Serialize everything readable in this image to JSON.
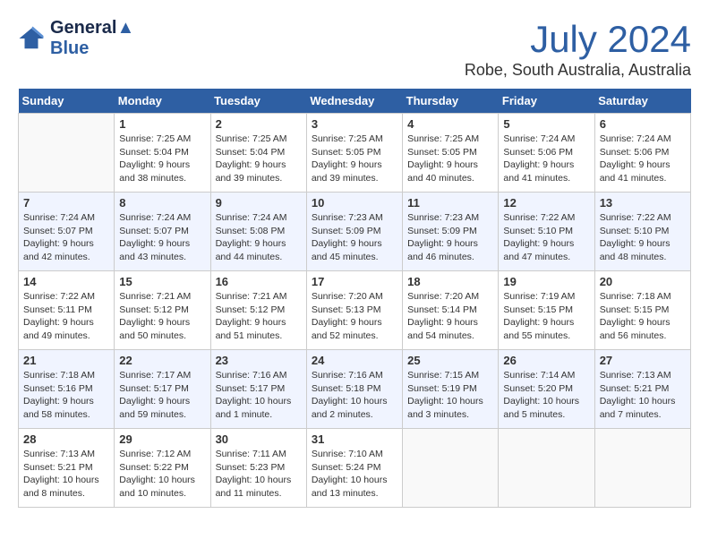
{
  "logo": {
    "line1": "General",
    "line2": "Blue"
  },
  "title": "July 2024",
  "location": "Robe, South Australia, Australia",
  "days_of_week": [
    "Sunday",
    "Monday",
    "Tuesday",
    "Wednesday",
    "Thursday",
    "Friday",
    "Saturday"
  ],
  "weeks": [
    [
      {
        "day": "",
        "info": ""
      },
      {
        "day": "1",
        "info": "Sunrise: 7:25 AM\nSunset: 5:04 PM\nDaylight: 9 hours\nand 38 minutes."
      },
      {
        "day": "2",
        "info": "Sunrise: 7:25 AM\nSunset: 5:04 PM\nDaylight: 9 hours\nand 39 minutes."
      },
      {
        "day": "3",
        "info": "Sunrise: 7:25 AM\nSunset: 5:05 PM\nDaylight: 9 hours\nand 39 minutes."
      },
      {
        "day": "4",
        "info": "Sunrise: 7:25 AM\nSunset: 5:05 PM\nDaylight: 9 hours\nand 40 minutes."
      },
      {
        "day": "5",
        "info": "Sunrise: 7:24 AM\nSunset: 5:06 PM\nDaylight: 9 hours\nand 41 minutes."
      },
      {
        "day": "6",
        "info": "Sunrise: 7:24 AM\nSunset: 5:06 PM\nDaylight: 9 hours\nand 41 minutes."
      }
    ],
    [
      {
        "day": "7",
        "info": "Sunrise: 7:24 AM\nSunset: 5:07 PM\nDaylight: 9 hours\nand 42 minutes."
      },
      {
        "day": "8",
        "info": "Sunrise: 7:24 AM\nSunset: 5:07 PM\nDaylight: 9 hours\nand 43 minutes."
      },
      {
        "day": "9",
        "info": "Sunrise: 7:24 AM\nSunset: 5:08 PM\nDaylight: 9 hours\nand 44 minutes."
      },
      {
        "day": "10",
        "info": "Sunrise: 7:23 AM\nSunset: 5:09 PM\nDaylight: 9 hours\nand 45 minutes."
      },
      {
        "day": "11",
        "info": "Sunrise: 7:23 AM\nSunset: 5:09 PM\nDaylight: 9 hours\nand 46 minutes."
      },
      {
        "day": "12",
        "info": "Sunrise: 7:22 AM\nSunset: 5:10 PM\nDaylight: 9 hours\nand 47 minutes."
      },
      {
        "day": "13",
        "info": "Sunrise: 7:22 AM\nSunset: 5:10 PM\nDaylight: 9 hours\nand 48 minutes."
      }
    ],
    [
      {
        "day": "14",
        "info": "Sunrise: 7:22 AM\nSunset: 5:11 PM\nDaylight: 9 hours\nand 49 minutes."
      },
      {
        "day": "15",
        "info": "Sunrise: 7:21 AM\nSunset: 5:12 PM\nDaylight: 9 hours\nand 50 minutes."
      },
      {
        "day": "16",
        "info": "Sunrise: 7:21 AM\nSunset: 5:12 PM\nDaylight: 9 hours\nand 51 minutes."
      },
      {
        "day": "17",
        "info": "Sunrise: 7:20 AM\nSunset: 5:13 PM\nDaylight: 9 hours\nand 52 minutes."
      },
      {
        "day": "18",
        "info": "Sunrise: 7:20 AM\nSunset: 5:14 PM\nDaylight: 9 hours\nand 54 minutes."
      },
      {
        "day": "19",
        "info": "Sunrise: 7:19 AM\nSunset: 5:15 PM\nDaylight: 9 hours\nand 55 minutes."
      },
      {
        "day": "20",
        "info": "Sunrise: 7:18 AM\nSunset: 5:15 PM\nDaylight: 9 hours\nand 56 minutes."
      }
    ],
    [
      {
        "day": "21",
        "info": "Sunrise: 7:18 AM\nSunset: 5:16 PM\nDaylight: 9 hours\nand 58 minutes."
      },
      {
        "day": "22",
        "info": "Sunrise: 7:17 AM\nSunset: 5:17 PM\nDaylight: 9 hours\nand 59 minutes."
      },
      {
        "day": "23",
        "info": "Sunrise: 7:16 AM\nSunset: 5:17 PM\nDaylight: 10 hours\nand 1 minute."
      },
      {
        "day": "24",
        "info": "Sunrise: 7:16 AM\nSunset: 5:18 PM\nDaylight: 10 hours\nand 2 minutes."
      },
      {
        "day": "25",
        "info": "Sunrise: 7:15 AM\nSunset: 5:19 PM\nDaylight: 10 hours\nand 3 minutes."
      },
      {
        "day": "26",
        "info": "Sunrise: 7:14 AM\nSunset: 5:20 PM\nDaylight: 10 hours\nand 5 minutes."
      },
      {
        "day": "27",
        "info": "Sunrise: 7:13 AM\nSunset: 5:21 PM\nDaylight: 10 hours\nand 7 minutes."
      }
    ],
    [
      {
        "day": "28",
        "info": "Sunrise: 7:13 AM\nSunset: 5:21 PM\nDaylight: 10 hours\nand 8 minutes."
      },
      {
        "day": "29",
        "info": "Sunrise: 7:12 AM\nSunset: 5:22 PM\nDaylight: 10 hours\nand 10 minutes."
      },
      {
        "day": "30",
        "info": "Sunrise: 7:11 AM\nSunset: 5:23 PM\nDaylight: 10 hours\nand 11 minutes."
      },
      {
        "day": "31",
        "info": "Sunrise: 7:10 AM\nSunset: 5:24 PM\nDaylight: 10 hours\nand 13 minutes."
      },
      {
        "day": "",
        "info": ""
      },
      {
        "day": "",
        "info": ""
      },
      {
        "day": "",
        "info": ""
      }
    ]
  ]
}
